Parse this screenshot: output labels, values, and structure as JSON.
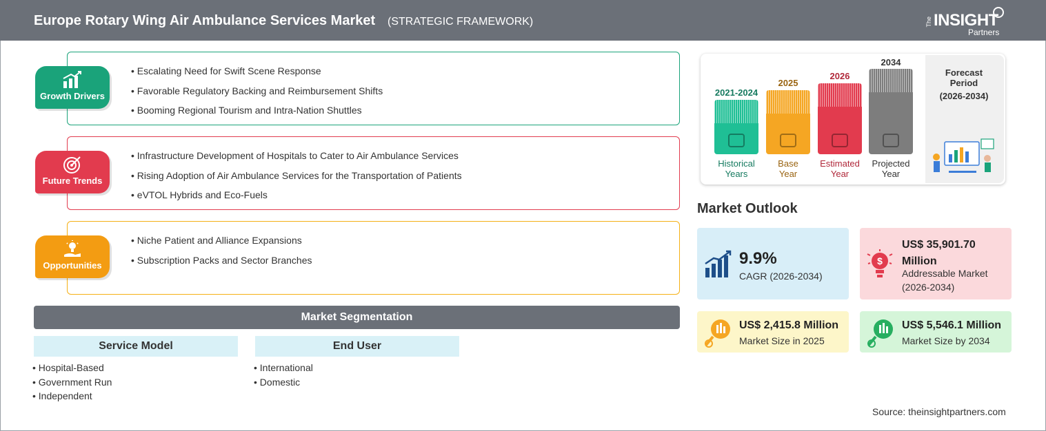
{
  "header": {
    "title": "Europe Rotary Wing Air Ambulance Services Market",
    "subtitle": "(STRATEGIC FRAMEWORK)",
    "logo": {
      "the": "The",
      "insight": "INSIGHT",
      "partners": "Partners"
    }
  },
  "growth_drivers": {
    "label": "Growth Drivers",
    "color": "#1aa37a",
    "items": [
      "Escalating Need for Swift Scene Response",
      "Favorable Regulatory Backing and Reimbursement Shifts",
      "Booming Regional Tourism and Intra-Nation Shuttles"
    ]
  },
  "future_trends": {
    "label": "Future Trends",
    "color": "#e23b4e",
    "items": [
      "Infrastructure Development of Hospitals to Cater to Air Ambulance Services",
      "Rising Adoption of Air Ambulance Services for the Transportation of Patients",
      "eVTOL Hybrids and Eco-Fuels"
    ]
  },
  "opportunities": {
    "label": "Opportunities",
    "color": "#f39c12",
    "items": [
      "Niche Patient and Alliance Expansions",
      "Subscription Packs and Sector Branches"
    ]
  },
  "segmentation": {
    "title": "Market Segmentation",
    "groups": [
      {
        "name": "Service Model",
        "items": [
          "Hospital-Based",
          "Government Run",
          "Independent"
        ]
      },
      {
        "name": "End User",
        "items": [
          "International",
          "Domestic"
        ]
      }
    ]
  },
  "timeline": {
    "periods": [
      {
        "year": "2021-2024",
        "label_line1": "Historical",
        "label_line2": "Years",
        "color": "#1fbf95",
        "text_color": "#157a5f"
      },
      {
        "year": "2025",
        "label_line1": "Base",
        "label_line2": "Year",
        "color": "#f5a623",
        "text_color": "#9a6411"
      },
      {
        "year": "2026",
        "label_line1": "Estimated",
        "label_line2": "Year",
        "color": "#e23b4e",
        "text_color": "#b0283a"
      },
      {
        "year": "2034",
        "label_line1": "Projected",
        "label_line2": "Year",
        "color": "#7d7d7d",
        "text_color": "#333333"
      }
    ],
    "forecast_line1": "Forecast",
    "forecast_line2": "Period",
    "forecast_range": "(2026-2034)"
  },
  "market_outlook": {
    "title": "Market Outlook",
    "cagr": {
      "value": "9.9%",
      "label": "CAGR (2026-2034)",
      "bg": "#d8eef8"
    },
    "addressable": {
      "value_line1": "US$ 35,901.70",
      "value_line2": "Million",
      "label_line1": "Addressable Market",
      "label_line2": "(2026-2034)",
      "bg": "#fbd9dc"
    },
    "size_2025": {
      "value": "US$ 2,415.8 Million",
      "label": "Market Size in 2025",
      "bg": "#fdf6c9"
    },
    "size_2034": {
      "value": "US$ 5,546.1 Million",
      "label": "Market Size by 2034",
      "bg": "#d5f5d9"
    }
  },
  "source": "Source: theinsightpartners.com"
}
